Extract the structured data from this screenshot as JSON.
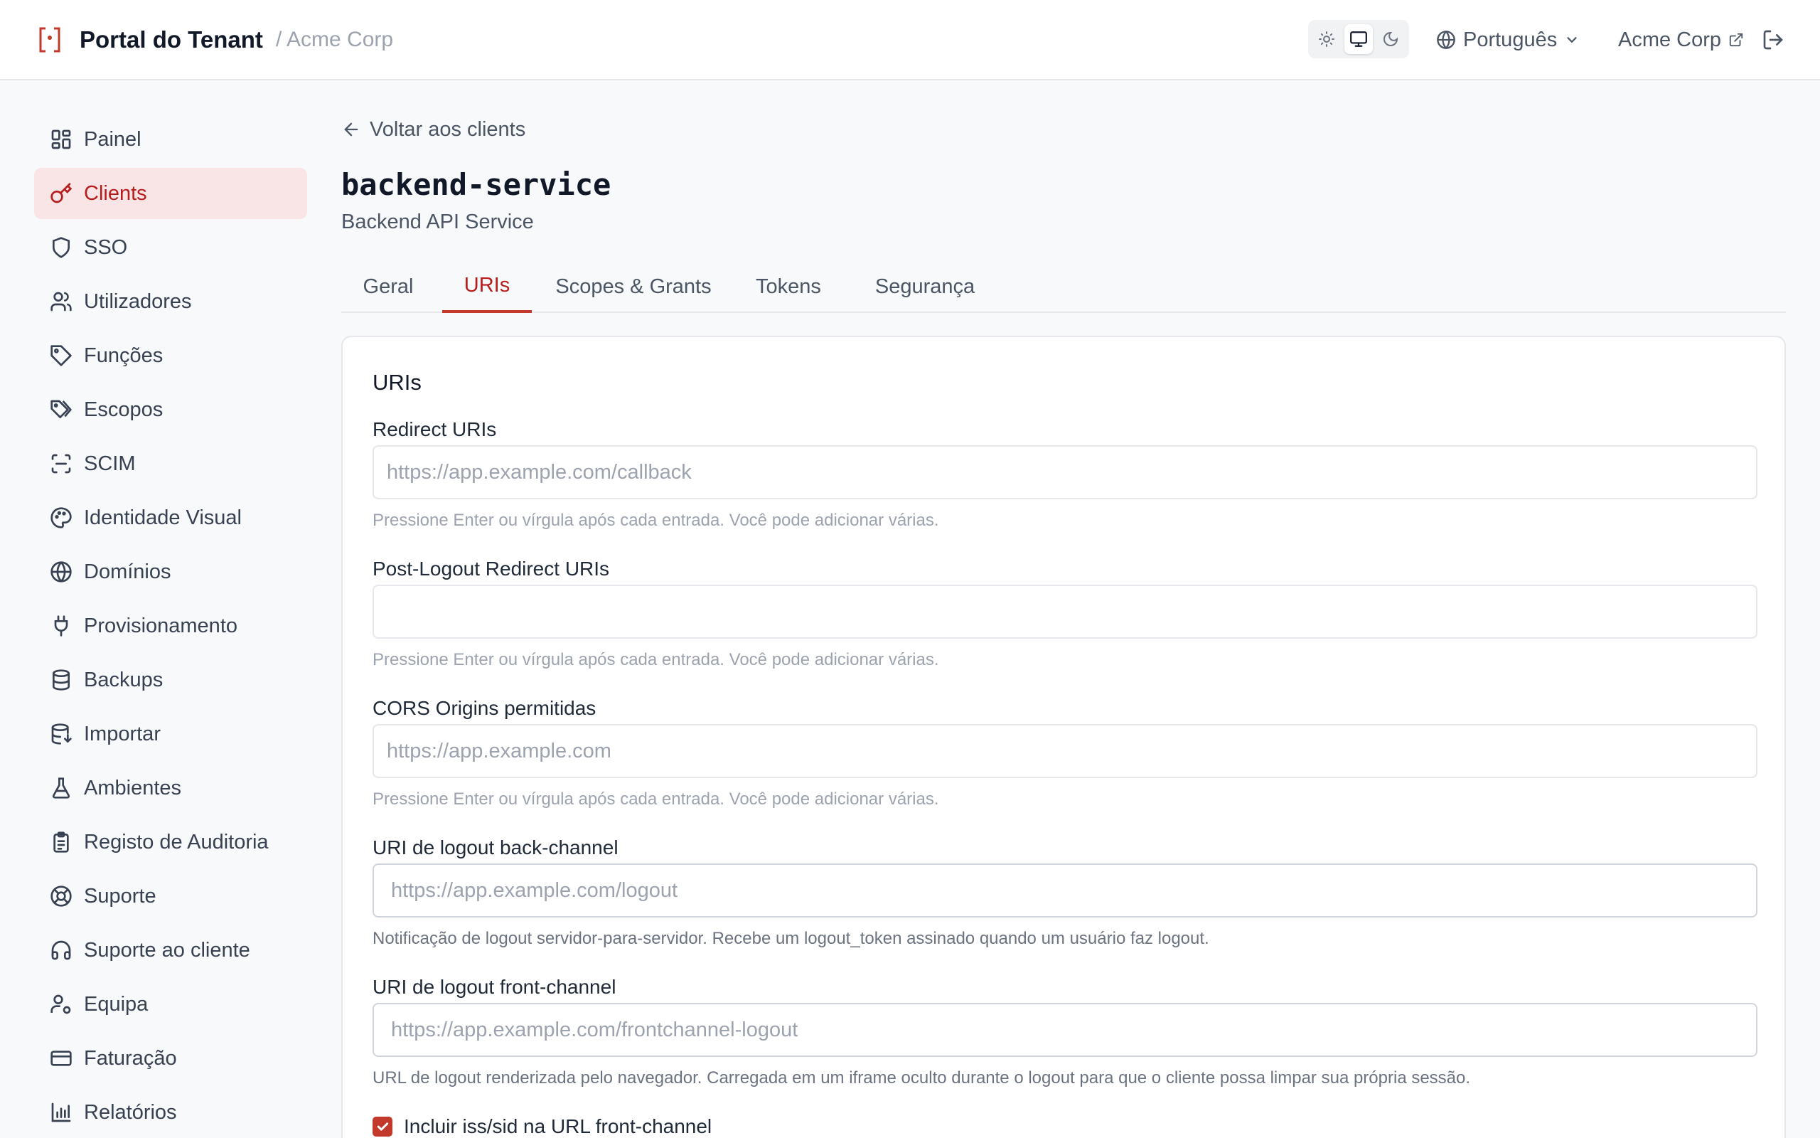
{
  "header": {
    "app_title": "Portal do Tenant",
    "tenant_breadcrumb": "/ Acme Corp",
    "language": "Português",
    "tenant_name": "Acme Corp"
  },
  "sidebar": {
    "items": [
      {
        "label": "Painel",
        "icon": "layout-dashboard-icon"
      },
      {
        "label": "Clients",
        "icon": "key-icon",
        "active": true
      },
      {
        "label": "SSO",
        "icon": "shield-icon"
      },
      {
        "label": "Utilizadores",
        "icon": "users-icon"
      },
      {
        "label": "Funções",
        "icon": "tag-icon"
      },
      {
        "label": "Escopos",
        "icon": "tags-icon"
      },
      {
        "label": "SCIM",
        "icon": "scan-icon"
      },
      {
        "label": "Identidade Visual",
        "icon": "palette-icon"
      },
      {
        "label": "Domínios",
        "icon": "globe-icon"
      },
      {
        "label": "Provisionamento",
        "icon": "plug-icon"
      },
      {
        "label": "Backups",
        "icon": "database-icon"
      },
      {
        "label": "Importar",
        "icon": "database-import-icon"
      },
      {
        "label": "Ambientes",
        "icon": "flask-icon"
      },
      {
        "label": "Registo de Auditoria",
        "icon": "clipboard-list-icon"
      },
      {
        "label": "Suporte",
        "icon": "life-buoy-icon"
      },
      {
        "label": "Suporte ao cliente",
        "icon": "headphones-icon"
      },
      {
        "label": "Equipa",
        "icon": "user-cog-icon"
      },
      {
        "label": "Faturação",
        "icon": "credit-card-icon"
      },
      {
        "label": "Relatórios",
        "icon": "bar-chart-icon"
      }
    ]
  },
  "main": {
    "back_label": "Voltar aos clients",
    "client_name": "backend-service",
    "client_description": "Backend API Service",
    "tabs": [
      {
        "label": "Geral"
      },
      {
        "label": "URIs",
        "active": true
      },
      {
        "label": "Scopes & Grants"
      },
      {
        "label": "Tokens"
      },
      {
        "label": "Segurança"
      }
    ],
    "card_title": "URIs",
    "fields": {
      "redirect": {
        "label": "Redirect URIs",
        "value": "",
        "placeholder": "https://app.example.com/callback",
        "help": "Pressione Enter ou vírgula após cada entrada. Você pode adicionar várias."
      },
      "post_logout": {
        "label": "Post-Logout Redirect URIs",
        "value": "",
        "placeholder": "",
        "help": "Pressione Enter ou vírgula após cada entrada. Você pode adicionar várias."
      },
      "cors": {
        "label": "CORS Origins permitidas",
        "value": "",
        "placeholder": "https://app.example.com",
        "help": "Pressione Enter ou vírgula após cada entrada. Você pode adicionar várias."
      },
      "backchannel": {
        "label": "URI de logout back-channel",
        "value": "",
        "placeholder": "https://app.example.com/logout",
        "help": "Notificação de logout servidor-para-servidor. Recebe um logout_token assinado quando um usuário faz logout."
      },
      "frontchannel": {
        "label": "URI de logout front-channel",
        "value": "",
        "placeholder": "https://app.example.com/frontchannel-logout",
        "help": "URL de logout renderizada pelo navegador. Carregada em um iframe oculto durante o logout para que o cliente possa limpar sua própria sessão."
      }
    },
    "include_iss_sid": {
      "label": "Incluir iss/sid na URL front-channel",
      "checked": true
    }
  },
  "colors": {
    "accent": "#c2392b",
    "active_bg": "#f9e5e5",
    "background": "#f8f9fa"
  }
}
